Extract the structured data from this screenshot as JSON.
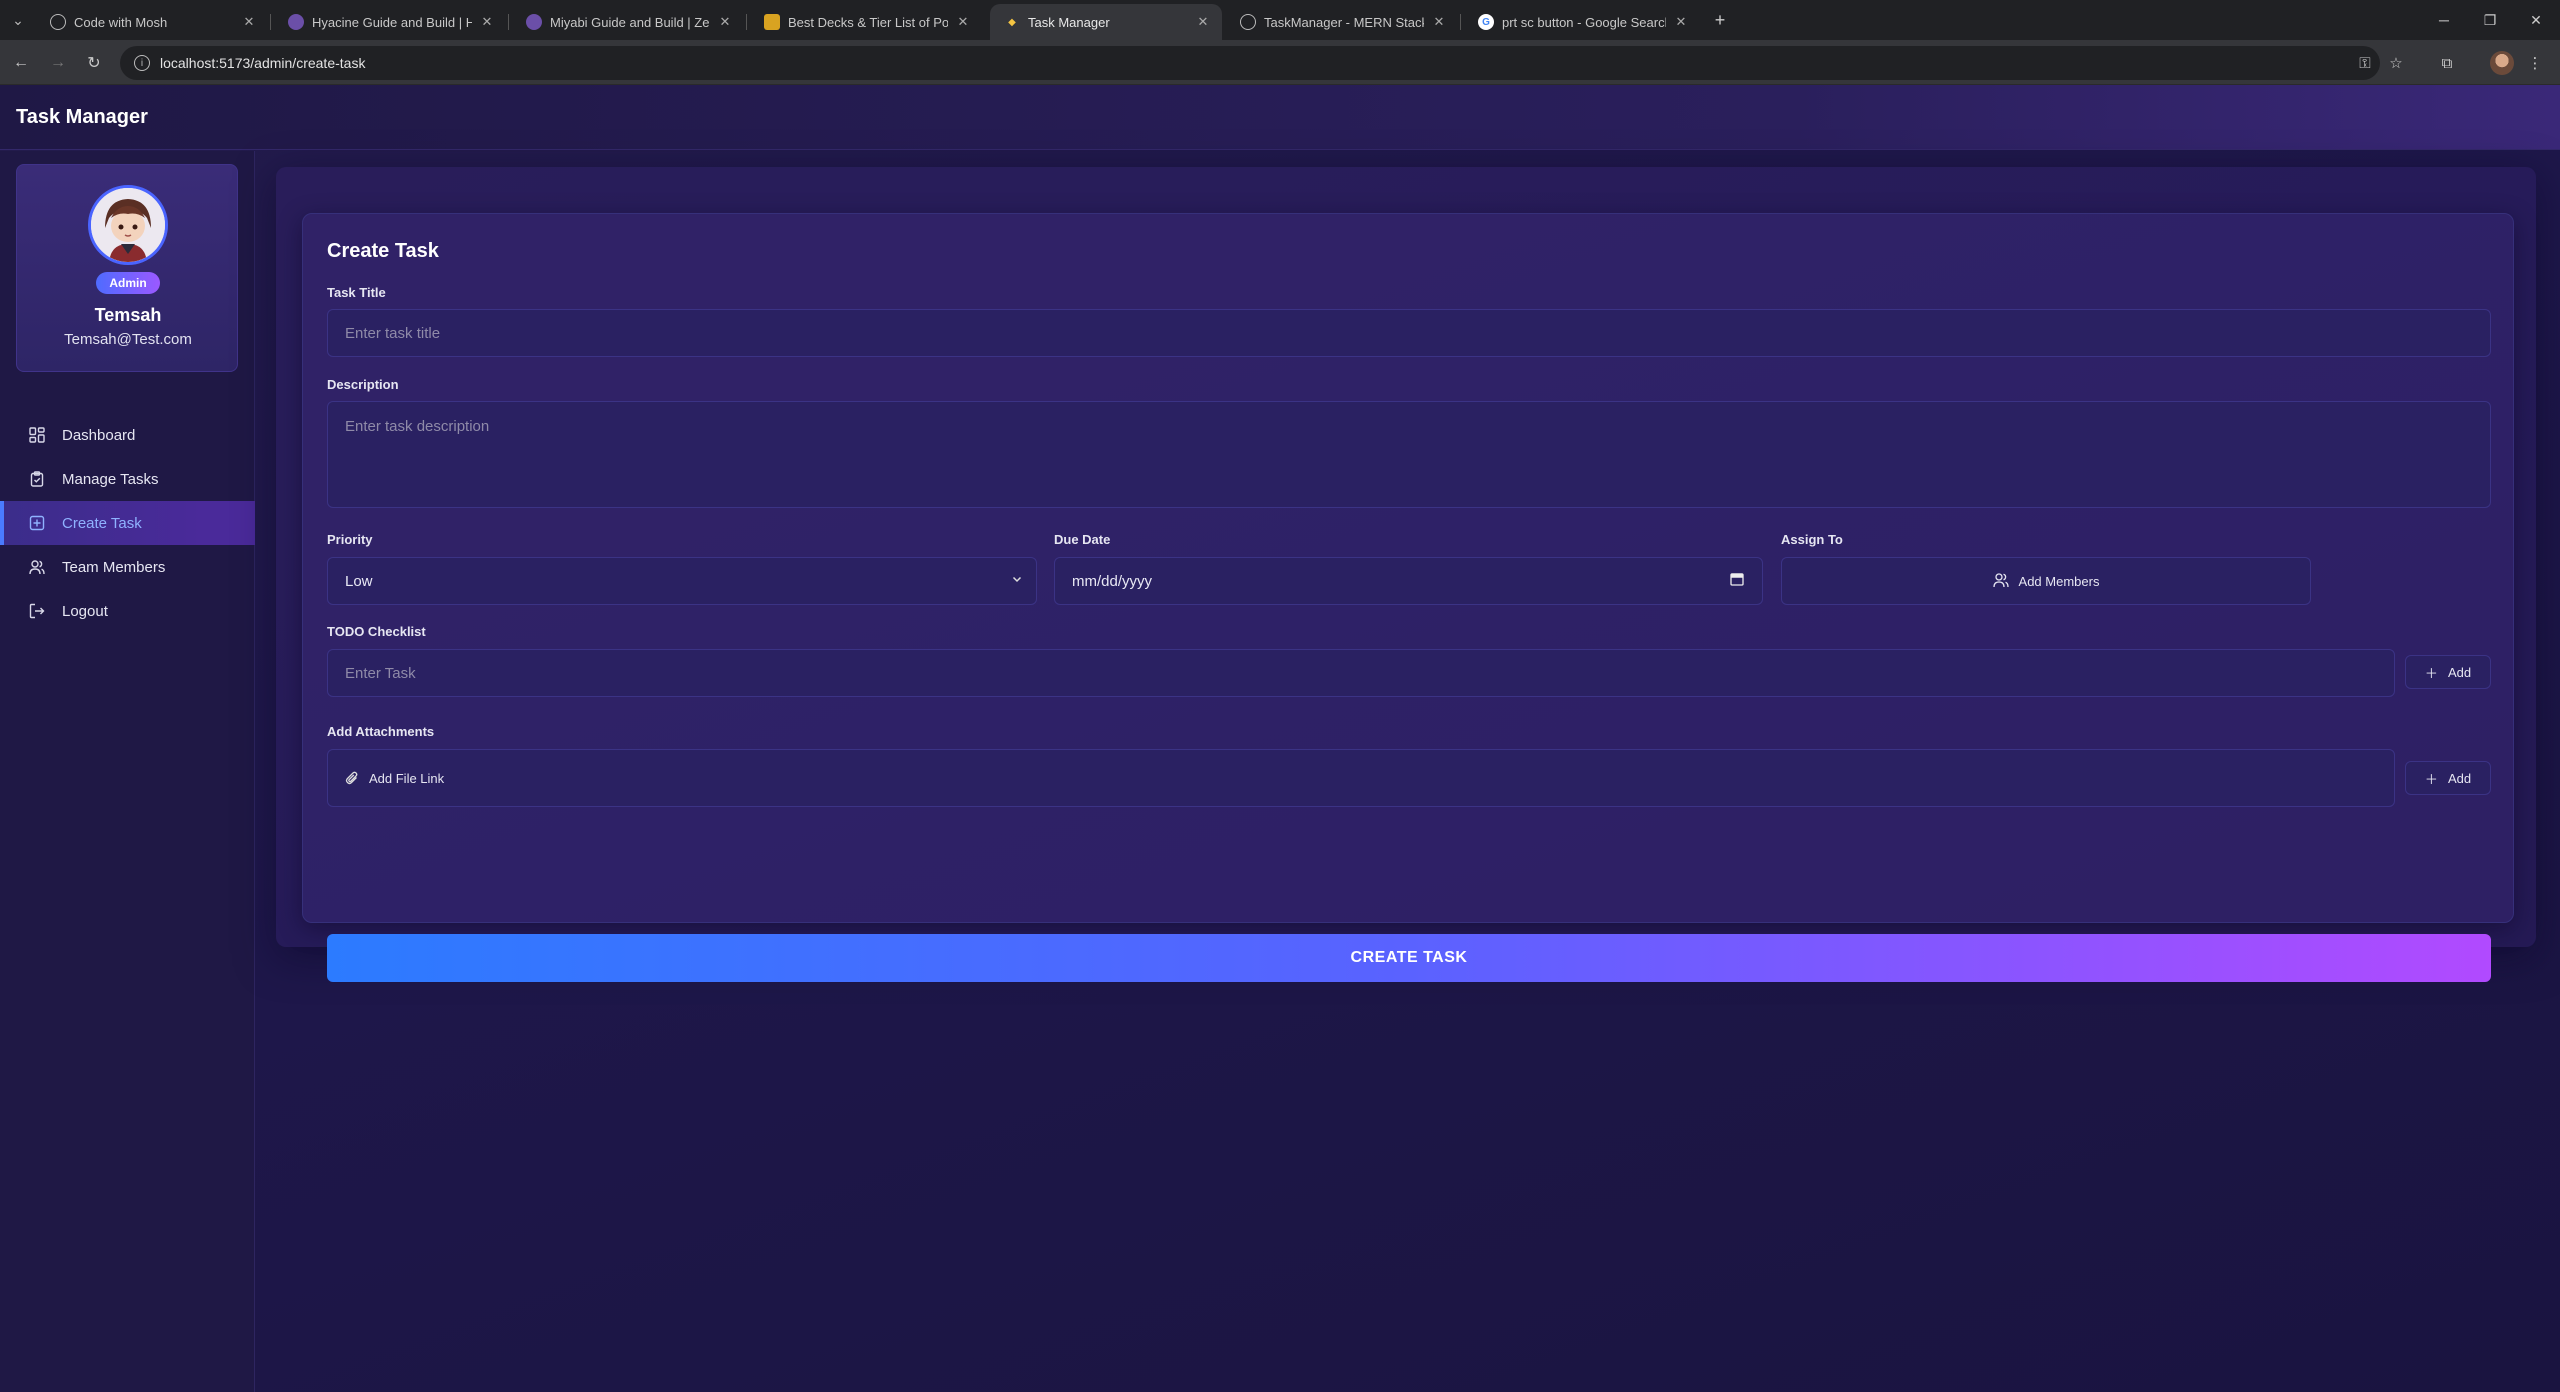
{
  "browser": {
    "tabs": [
      {
        "title": "Code with Mosh",
        "active": false
      },
      {
        "title": "Hyacine Guide and Build | Honk",
        "active": false
      },
      {
        "title": "Miyabi Guide and Build | Zenless",
        "active": false
      },
      {
        "title": "Best Decks & Tier List of Pokém",
        "active": false
      },
      {
        "title": "Task Manager",
        "active": true
      },
      {
        "title": "TaskManager - MERN Stack Proj",
        "active": false
      },
      {
        "title": "prt sc button - Google Search",
        "active": false
      }
    ],
    "url": "localhost:5173/admin/create-task"
  },
  "app": {
    "brand": "Task Manager"
  },
  "profile": {
    "role": "Admin",
    "name": "Temsah",
    "email": "Temsah@Test.com"
  },
  "sidebar": {
    "items": [
      {
        "label": "Dashboard",
        "icon": "dashboard-icon",
        "active": false
      },
      {
        "label": "Manage Tasks",
        "icon": "clipboard-icon",
        "active": false
      },
      {
        "label": "Create Task",
        "icon": "plus-square-icon",
        "active": true
      },
      {
        "label": "Team Members",
        "icon": "users-icon",
        "active": false
      },
      {
        "label": "Logout",
        "icon": "logout-icon",
        "active": false
      }
    ]
  },
  "form": {
    "title": "Create Task",
    "task_title_label": "Task Title",
    "task_title_placeholder": "Enter task title",
    "description_label": "Description",
    "description_placeholder": "Enter task description",
    "priority_label": "Priority",
    "priority_value": "Low",
    "due_date_label": "Due Date",
    "due_date_value": "mm/dd/yyyy",
    "assign_to_label": "Assign To",
    "add_members_label": "Add Members",
    "todo_label": "TODO Checklist",
    "todo_placeholder": "Enter Task",
    "todo_add_label": "Add",
    "attachments_label": "Add Attachments",
    "attachment_placeholder": "Add File Link",
    "attachment_add_label": "Add",
    "submit_label": "CREATE TASK"
  },
  "colors": {
    "accent": "#4a7bff",
    "gradient_start": "#2c7bff",
    "gradient_end": "#b14aff"
  }
}
